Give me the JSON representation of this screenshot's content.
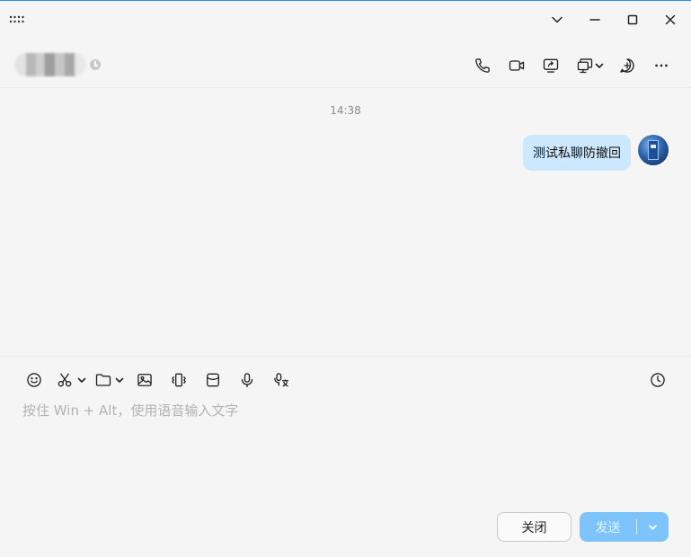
{
  "window": {
    "controls": {
      "menu_icon": "grid-dots-icon",
      "collapse_icon": "chevron-down-icon",
      "minimize_icon": "minimize-icon",
      "maximize_icon": "maximize-icon",
      "close_icon": "close-icon"
    }
  },
  "header": {
    "contact_name_blurred": true,
    "status_icon": "clock-icon",
    "actions": [
      "phone-icon",
      "video-icon",
      "screen-share-icon",
      "remote-desktop-icon",
      "add-member-icon",
      "more-icon"
    ]
  },
  "chat": {
    "timestamp": "14:38",
    "messages": [
      {
        "sender": "self",
        "text": "测试私聊防撤回"
      }
    ]
  },
  "composer": {
    "toolbar": [
      "emoji-icon",
      "screenshot-icon",
      "folder-icon",
      "image-icon",
      "shake-icon",
      "red-packet-icon",
      "microphone-icon",
      "voice-to-text-icon",
      "history-icon"
    ],
    "placeholder": "按住 Win + Alt，使用语音输入文字",
    "close_label": "关闭",
    "send_label": "发送"
  },
  "colors": {
    "background": "#f5f5f5",
    "bubble": "#cce8ff",
    "send_button": "#7cc4fb",
    "accent_line": "#2d8cf0"
  }
}
